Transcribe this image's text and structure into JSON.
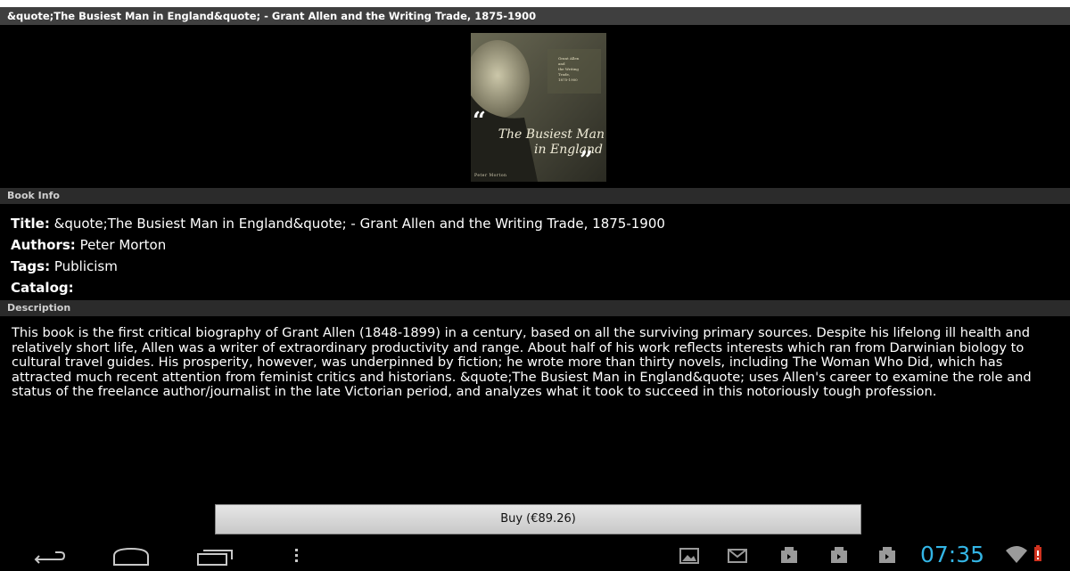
{
  "title_bar": "&quote;The Busiest Man in England&quote; -  Grant Allen and the Writing Trade, 1875-1900",
  "cover": {
    "line1": "Grant Allen",
    "line2": "and",
    "line3": "the Writing",
    "line4": "Trade,",
    "line5": "1875-1900",
    "big_title_1": "The Busiest Man",
    "big_title_2": "in England",
    "author": "Peter Morton"
  },
  "book_info_header": "Book Info",
  "info": {
    "title_label": "Title:",
    "title_value": "&quote;The Busiest Man in England&quote; -  Grant Allen and the Writing Trade, 1875-1900",
    "authors_label": "Authors:",
    "authors_value": "Peter Morton",
    "tags_label": "Tags:",
    "tags_value": "Publicism",
    "catalog_label": "Catalog:",
    "catalog_value": ""
  },
  "description_header": "Description",
  "description": "This book is the first critical biography of Grant Allen (1848-1899) in a century, based on all the surviving primary sources. Despite his lifelong ill health and relatively short life, Allen was a writer of extraordinary productivity and range. About half of his work reflects interests which ran from Darwinian biology to cultural travel guides. His prosperity, however, was underpinned by fiction; he wrote more than thirty novels, including The Woman Who Did, which has attracted much recent attention from feminist critics and historians. &quote;The Busiest Man in England&quote; uses Allen's career to examine the role and status of the freelance author/journalist in the late Victorian period, and analyzes what it took to succeed in this notoriously tough profession.",
  "buy_label": "Buy (€89.26)",
  "status": {
    "time": "07:35",
    "accent": "#33b5e5"
  },
  "icons": [
    "back-icon",
    "home-icon",
    "recent-apps-icon",
    "menu-icon",
    "gallery-icon",
    "gmail-icon",
    "download-icon",
    "download-icon",
    "download-icon",
    "wifi-icon",
    "battery-icon"
  ]
}
